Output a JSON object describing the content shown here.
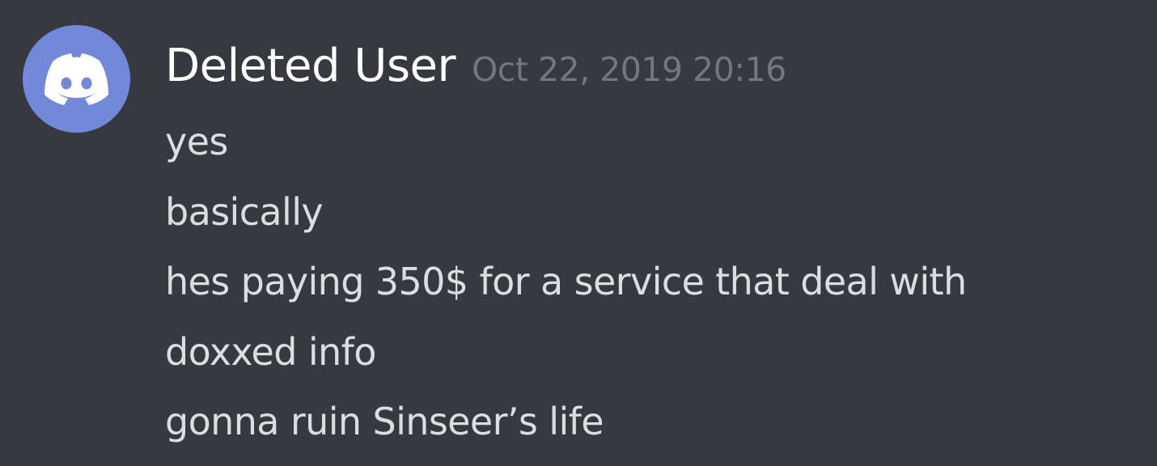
{
  "message": {
    "username": "Deleted User",
    "timestamp": "Oct 22, 2019 20:16",
    "avatar_icon": "discord-logo-icon",
    "lines": [
      "yes",
      "basically",
      "hes paying 350$ for a service that deal with",
      "doxxed info",
      "gonna ruin Sinseer’s life"
    ]
  },
  "colors": {
    "background": "#36393f",
    "avatar": "#7289da",
    "username": "#ffffff",
    "timestamp": "#72767d",
    "text": "#dcddde"
  }
}
